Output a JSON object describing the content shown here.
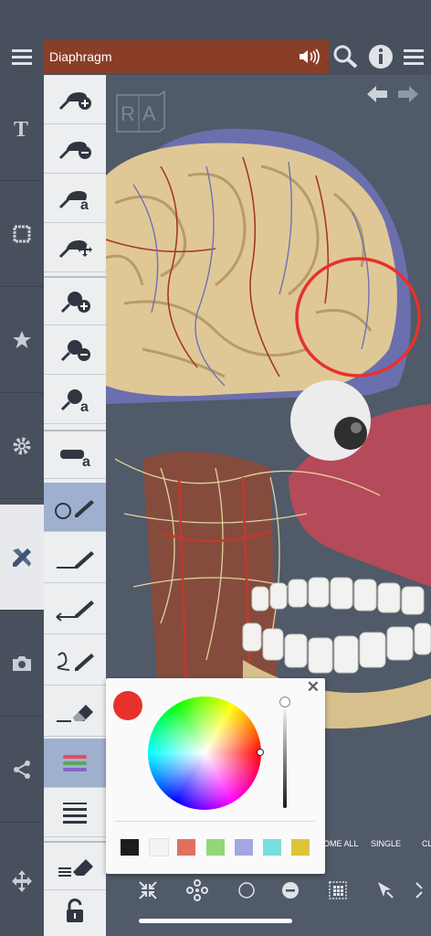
{
  "header": {
    "title": "Diaphragm"
  },
  "viewport": {
    "cube_letters": [
      "R",
      "A"
    ]
  },
  "color_picker": {
    "current_color": "#e8312b",
    "swatches": [
      "#1c1c1c",
      "#f4f2f2",
      "#e07060",
      "#94d67b",
      "#a3a6e4",
      "#79dede",
      "#ddc43a"
    ]
  },
  "bottom_toolbar": {
    "labels": {
      "home_all": "OME ALL",
      "single": "SINGLE",
      "cl": "CL"
    }
  },
  "colors": {
    "title_bar": "#8a3e28",
    "annotation_circle": "#e8312b",
    "selected_tool": "#9fb0cf"
  }
}
